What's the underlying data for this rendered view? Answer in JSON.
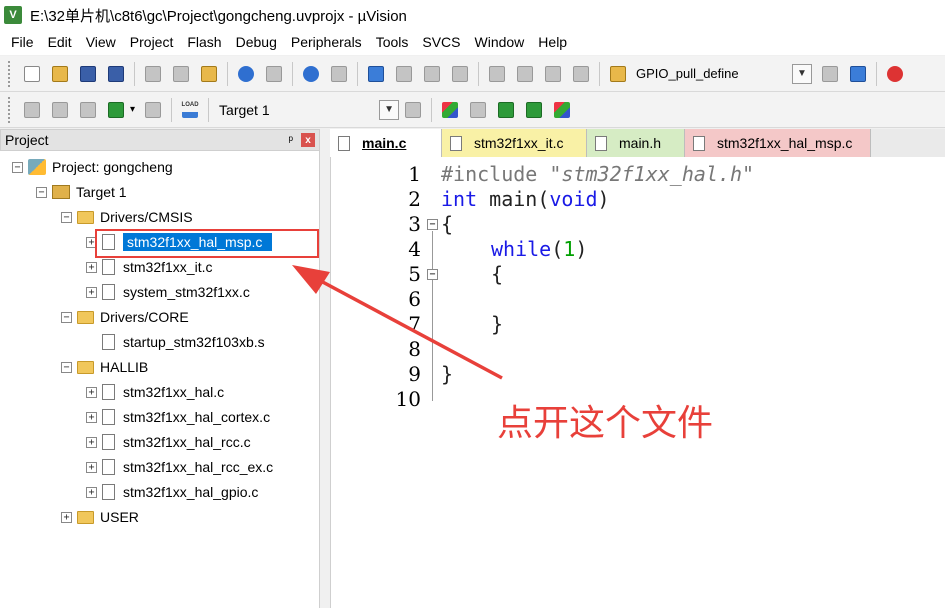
{
  "window": {
    "title": "E:\\32单片机\\c8t6\\gc\\Project\\gongcheng.uvprojx - µVision",
    "icon_label": "V"
  },
  "menu": [
    "File",
    "Edit",
    "View",
    "Project",
    "Flash",
    "Debug",
    "Peripherals",
    "Tools",
    "SVCS",
    "Window",
    "Help"
  ],
  "toolbar": {
    "find_combo": "GPIO_pull_define",
    "target": "Target 1",
    "load_label": "LOAD"
  },
  "project_panel": {
    "title": "Project",
    "pin": "ᵖ",
    "close": "x",
    "root": "Project: gongcheng",
    "target": "Target 1",
    "groups": [
      {
        "name": "Drivers/CMSIS",
        "files": [
          "stm32f1xx_hal_msp.c",
          "stm32f1xx_it.c",
          "system_stm32f1xx.c"
        ]
      },
      {
        "name": "Drivers/CORE",
        "files": [
          "startup_stm32f103xb.s"
        ]
      },
      {
        "name": "HALLIB",
        "files": [
          "stm32f1xx_hal.c",
          "stm32f1xx_hal_cortex.c",
          "stm32f1xx_hal_rcc.c",
          "stm32f1xx_hal_rcc_ex.c",
          "stm32f1xx_hal_gpio.c"
        ]
      },
      {
        "name": "USER",
        "files": []
      }
    ]
  },
  "tabs": [
    "main.c",
    "stm32f1xx_it.c",
    "main.h",
    "stm32f1xx_hal_msp.c"
  ],
  "editor": {
    "line_numbers": [
      "1",
      "2",
      "3",
      "4",
      "5",
      "6",
      "7",
      "8",
      "9",
      "10"
    ],
    "code": {
      "l1_pp": "#include ",
      "l1_str": "\"stm32f1xx_hal.h\"",
      "l2_kw1": "int",
      "l2_rest": " main(",
      "l2_kw2": "void",
      "l2_end": ")",
      "l3": "{",
      "l4_kw": "while",
      "l4_open": "(",
      "l4_num": "1",
      "l4_close": ")",
      "l5": "{",
      "l7": "}",
      "l9": "}"
    }
  },
  "annotation": {
    "text": "点开这个文件",
    "color": "#e8403a"
  },
  "colors": {
    "selection": "#0078d7",
    "highlight_box": "#e8403a",
    "keyword": "#1a1ae6"
  }
}
